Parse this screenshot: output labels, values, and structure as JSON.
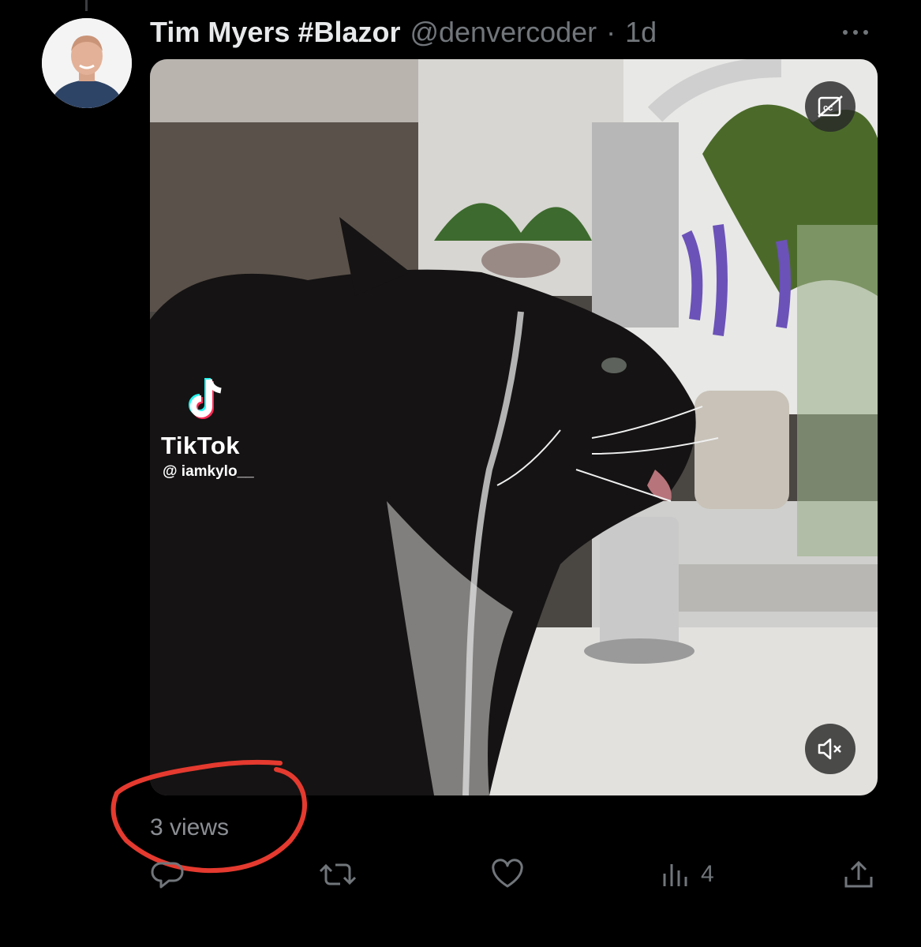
{
  "tweet": {
    "display_name": "Tim Myers #Blazor",
    "handle": "@denvercoder",
    "separator": "·",
    "time": "1d",
    "view_count_label": "3 views"
  },
  "media": {
    "watermark_brand": "TikTok",
    "watermark_user": "@ iamkylo__",
    "captions_icon": "closed-captions-off-icon",
    "mute_icon": "speaker-muted-icon"
  },
  "actions": {
    "reply_icon": "reply-icon",
    "retweet_icon": "retweet-icon",
    "like_icon": "heart-icon",
    "views_icon": "analytics-icon",
    "views_count": "4",
    "share_icon": "share-icon"
  },
  "colors": {
    "background": "#000000",
    "text_primary": "#e7e9ea",
    "text_secondary": "#71767b",
    "annotation": "#e53a2f"
  }
}
